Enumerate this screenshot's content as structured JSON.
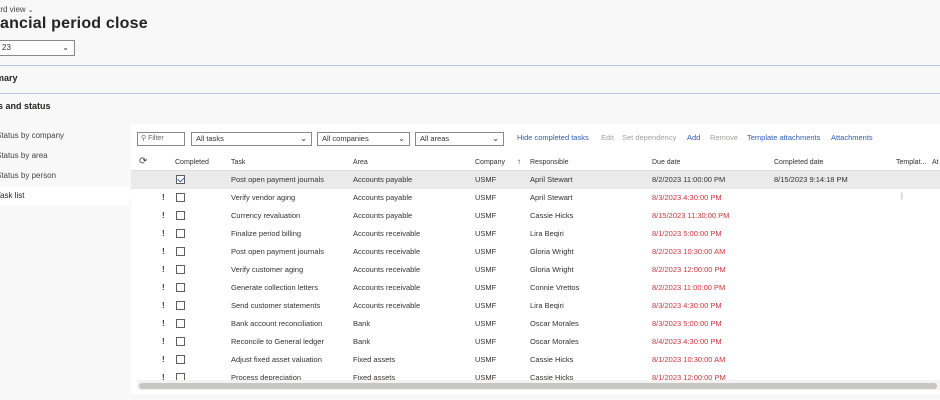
{
  "header": {
    "view_label": "ndard view",
    "title": "nancial period close",
    "year_value": "23"
  },
  "fasttabs": {
    "summary": "mmary",
    "tasks_and_status": "sks and status"
  },
  "side_nav": [
    {
      "label": "Status by company",
      "active": false
    },
    {
      "label": "Status by area",
      "active": false
    },
    {
      "label": "Status by person",
      "active": false
    },
    {
      "label": "Task list",
      "active": true
    }
  ],
  "toolbar": {
    "filter_placeholder": "Filter",
    "tasks_filter": "All tasks",
    "companies_filter": "All companies",
    "areas_filter": "All areas",
    "actions": [
      {
        "label": "Hide completed tasks",
        "enabled": true
      },
      {
        "label": "Edit",
        "enabled": false
      },
      {
        "label": "Set dependency",
        "enabled": false
      },
      {
        "label": "Add",
        "enabled": true
      },
      {
        "label": "Remove",
        "enabled": false
      },
      {
        "label": "Template attachments",
        "enabled": true
      },
      {
        "label": "Attachments",
        "enabled": true
      }
    ]
  },
  "columns": {
    "completed": "Completed",
    "task": "Task",
    "area": "Area",
    "company": "Company",
    "responsible": "Responsible",
    "due_date": "Due date",
    "completed_date": "Completed date",
    "template": "Templat...",
    "attachments": "At"
  },
  "rows": [
    {
      "flag": "",
      "completed": true,
      "task": "Post open payment journals",
      "area": "Accounts payable",
      "company": "USMF",
      "responsible": "April Stewart",
      "due": "8/2/2023 11:00:00 PM",
      "overdue": false,
      "completed_date": "8/15/2023 9:14:18 PM",
      "attachment": false
    },
    {
      "flag": "!",
      "completed": false,
      "task": "Verify vendor aging",
      "area": "Accounts payable",
      "company": "USMF",
      "responsible": "April Stewart",
      "due": "8/3/2023 4:30:00 PM",
      "overdue": true,
      "completed_date": "",
      "attachment": true
    },
    {
      "flag": "!",
      "completed": false,
      "task": "Currency revaluation",
      "area": "Accounts payable",
      "company": "USMF",
      "responsible": "Cassie Hicks",
      "due": "8/15/2023 11:30:00 PM",
      "overdue": true,
      "completed_date": "",
      "attachment": false
    },
    {
      "flag": "!",
      "completed": false,
      "task": "Finalize period billing",
      "area": "Accounts receivable",
      "company": "USMF",
      "responsible": "Lira Beqiri",
      "due": "8/1/2023 5:00:00 PM",
      "overdue": true,
      "completed_date": "",
      "attachment": false
    },
    {
      "flag": "!",
      "completed": false,
      "task": "Post open payment journals",
      "area": "Accounts receivable",
      "company": "USMF",
      "responsible": "Gloria Wright",
      "due": "8/2/2023 10:30:00 AM",
      "overdue": true,
      "completed_date": "",
      "attachment": false
    },
    {
      "flag": "!",
      "completed": false,
      "task": "Verify customer aging",
      "area": "Accounts receivable",
      "company": "USMF",
      "responsible": "Gloria Wright",
      "due": "8/2/2023 12:00:00 PM",
      "overdue": true,
      "completed_date": "",
      "attachment": false
    },
    {
      "flag": "!",
      "completed": false,
      "task": "Generate collection letters",
      "area": "Accounts receivable",
      "company": "USMF",
      "responsible": "Connie Vrettos",
      "due": "8/2/2023 11:00:00 PM",
      "overdue": true,
      "completed_date": "",
      "attachment": false
    },
    {
      "flag": "!",
      "completed": false,
      "task": "Send customer statements",
      "area": "Accounts receivable",
      "company": "USMF",
      "responsible": "Lira Beqiri",
      "due": "8/3/2023 4:30:00 PM",
      "overdue": true,
      "completed_date": "",
      "attachment": false
    },
    {
      "flag": "!",
      "completed": false,
      "task": "Bank account reconciliation",
      "area": "Bank",
      "company": "USMF",
      "responsible": "Oscar Morales",
      "due": "8/3/2023 5:00:00 PM",
      "overdue": true,
      "completed_date": "",
      "attachment": false
    },
    {
      "flag": "!",
      "completed": false,
      "task": "Reconcile to General ledger",
      "area": "Bank",
      "company": "USMF",
      "responsible": "Oscar Morales",
      "due": "8/4/2023 4:30:00 PM",
      "overdue": true,
      "completed_date": "",
      "attachment": false
    },
    {
      "flag": "!",
      "completed": false,
      "task": "Adjust fixed asset valuation",
      "area": "Fixed assets",
      "company": "USMF",
      "responsible": "Cassie Hicks",
      "due": "8/1/2023 10:30:00 AM",
      "overdue": true,
      "completed_date": "",
      "attachment": false
    },
    {
      "flag": "!",
      "completed": false,
      "task": "Process depreciation",
      "area": "Fixed assets",
      "company": "USMF",
      "responsible": "Cassie Hicks",
      "due": "8/1/2023 12:00:00 PM",
      "overdue": true,
      "completed_date": "",
      "attachment": false
    }
  ],
  "icons": {
    "chevron": "chevron-down-icon",
    "search": "search-icon",
    "refresh": "refresh-icon",
    "sort": "sort-ascending-icon",
    "attachment": "paperclip-icon"
  },
  "colors": {
    "link": "#2b5db8",
    "overdue": "#d13438",
    "fasttab_border": "#b7c7e8"
  }
}
